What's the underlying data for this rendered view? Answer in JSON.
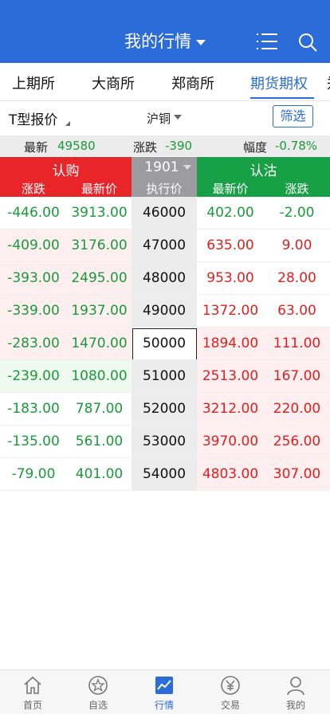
{
  "header": {
    "title": "我的行情"
  },
  "exchange_tabs": [
    "上期所",
    "大商所",
    "郑商所",
    "期货期权",
    "郑"
  ],
  "active_tab_index": 3,
  "filter": {
    "t_label": "T型报价",
    "contract": "沪铜",
    "filter_button": "筛选"
  },
  "summary": {
    "latest_label": "最新",
    "latest_value": "49580",
    "change_label": "涨跌",
    "change_value": "-390",
    "pct_label": "幅度",
    "pct_value": "-0.78%"
  },
  "table_header": {
    "call_title": "认购",
    "strike_title": "1901",
    "put_title": "认沽",
    "call_change": "涨跌",
    "call_price": "最新价",
    "strike": "执行价",
    "put_price": "最新价",
    "put_change": "涨跌"
  },
  "rows": [
    {
      "call_change": "-446.00",
      "call_price": "3913.00",
      "strike": "46000",
      "put_price": "402.00",
      "put_change": "-2.00"
    },
    {
      "call_change": "-409.00",
      "call_price": "3176.00",
      "strike": "47000",
      "put_price": "635.00",
      "put_change": "9.00"
    },
    {
      "call_change": "-393.00",
      "call_price": "2495.00",
      "strike": "48000",
      "put_price": "953.00",
      "put_change": "28.00"
    },
    {
      "call_change": "-339.00",
      "call_price": "1937.00",
      "strike": "49000",
      "put_price": "1372.00",
      "put_change": "63.00"
    },
    {
      "call_change": "-283.00",
      "call_price": "1470.00",
      "strike": "50000",
      "put_price": "1894.00",
      "put_change": "111.00"
    },
    {
      "call_change": "-239.00",
      "call_price": "1080.00",
      "strike": "51000",
      "put_price": "2513.00",
      "put_change": "167.00"
    },
    {
      "call_change": "-183.00",
      "call_price": "787.00",
      "strike": "52000",
      "put_price": "3212.00",
      "put_change": "220.00"
    },
    {
      "call_change": "-135.00",
      "call_price": "561.00",
      "strike": "53000",
      "put_price": "3970.00",
      "put_change": "256.00"
    },
    {
      "call_change": "-79.00",
      "call_price": "401.00",
      "strike": "54000",
      "put_price": "4803.00",
      "put_change": "307.00"
    }
  ],
  "bottom_nav": [
    {
      "label": "首页",
      "icon": "home-icon"
    },
    {
      "label": "自选",
      "icon": "star-icon"
    },
    {
      "label": "行情",
      "icon": "chart-icon"
    },
    {
      "label": "交易",
      "icon": "yen-icon"
    },
    {
      "label": "我的",
      "icon": "user-icon"
    }
  ],
  "active_nav_index": 2,
  "colors": {
    "brand_blue": "#2c6cd8",
    "call_red": "#e8262a",
    "put_green": "#17a045",
    "up": "#e0201e",
    "down": "#1a9a3a"
  }
}
